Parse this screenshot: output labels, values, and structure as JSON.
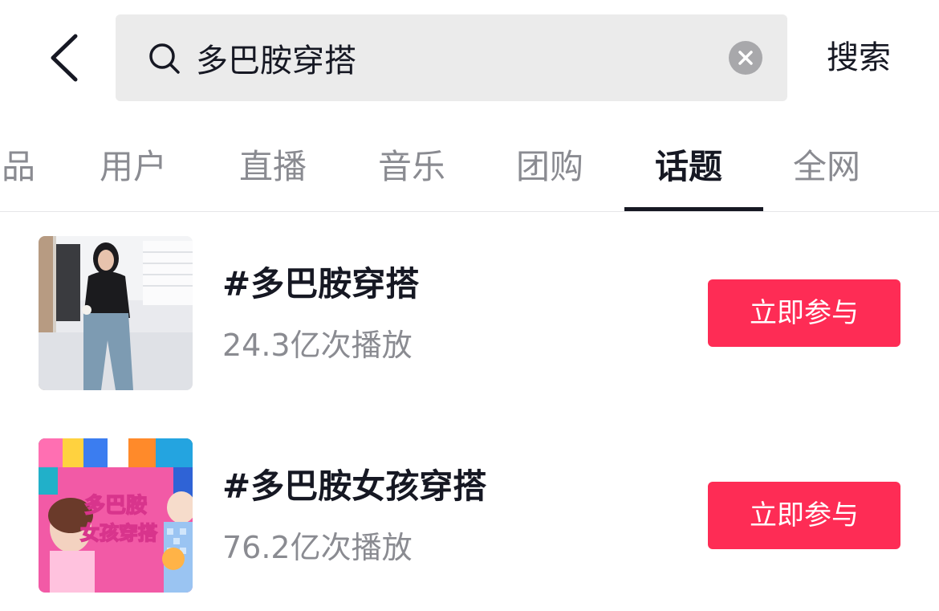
{
  "header": {
    "back_icon": "chevron-left-icon",
    "search": {
      "value": "多巴胺穿搭",
      "search_icon": "search-icon",
      "clear_icon": "close-circle-icon"
    },
    "submit_label": "搜索"
  },
  "tabs": [
    {
      "label": "品",
      "active": false
    },
    {
      "label": "用户",
      "active": false
    },
    {
      "label": "直播",
      "active": false
    },
    {
      "label": "音乐",
      "active": false
    },
    {
      "label": "团购",
      "active": false
    },
    {
      "label": "话题",
      "active": true
    },
    {
      "label": "全网",
      "active": false
    }
  ],
  "topics": [
    {
      "title": "#多巴胺穿搭",
      "plays": "24.3亿次播放",
      "button_label": "立即参与"
    },
    {
      "title": "#多巴胺女孩穿搭",
      "plays": "76.2亿次播放",
      "button_label": "立即参与",
      "thumbnail_text": "多巴胺女孩穿搭"
    }
  ],
  "colors": {
    "accent": "#fe2c55",
    "text_primary": "#161823",
    "text_secondary": "#8a8b91",
    "search_bg": "#ebebeb"
  }
}
